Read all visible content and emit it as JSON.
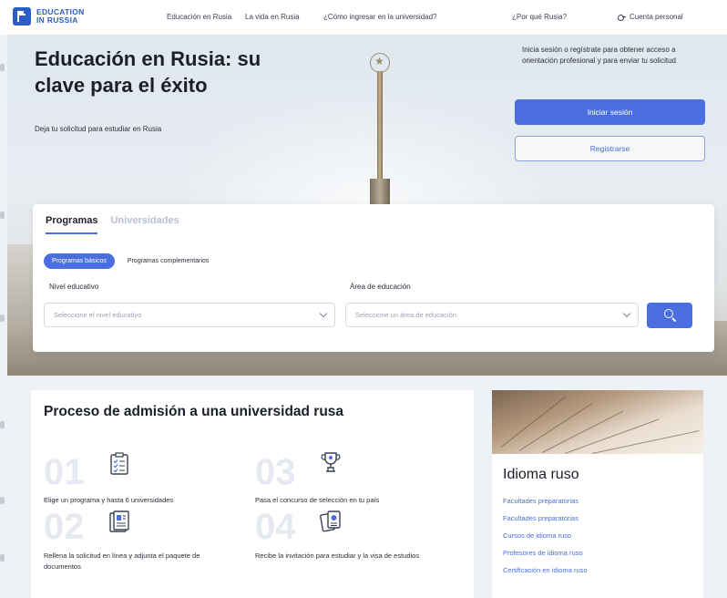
{
  "header": {
    "logo_line1": "EDUCATION",
    "logo_line2": "IN RUSSIA",
    "nav": [
      "Educación en Rusia",
      "La vida en Rusia",
      "¿Cómo ingresar en la universidad?",
      "¿Por qué Rusia?"
    ],
    "account": "Cuenta personal"
  },
  "hero": {
    "title": "Educación en Rusia: su clave para el éxito",
    "subtitle": "Deja tu solicitud para estudiar en Rusia",
    "login_text": "Inicia sesión o regístrate para obtener acceso a orientación profesional y para enviar tu solicitud",
    "login_button": "Iniciar sesión",
    "register_button": "Registrarse"
  },
  "search": {
    "tabs": [
      "Programas",
      "Universidades"
    ],
    "pills": [
      "Programas básicos",
      "Programas complementarios"
    ],
    "level_label": "Nivel educativo",
    "level_placeholder": "Seleccione el nivel educativo",
    "area_label": "Área de educación",
    "area_placeholder": "Seleccione un área de educación"
  },
  "admission": {
    "title": "Proceso de admisión a una universidad rusa",
    "steps": [
      {
        "num": "01",
        "text": "Elige un programa y hasta 6 universidades",
        "icon": "checklist-icon"
      },
      {
        "num": "03",
        "text": "Pasa el concurso de selección en tu país",
        "icon": "trophy-icon"
      },
      {
        "num": "02",
        "text": "Rellena la solicitud en línea y adjunta el paquete de documentos",
        "icon": "document-icon"
      },
      {
        "num": "04",
        "text": "Recibe la invitación para estudiar y la visa de estudios",
        "icon": "passport-icon"
      }
    ]
  },
  "russian": {
    "title": "Idioma ruso",
    "links": [
      "Facultades preparatorias",
      "Facultades preparatorias",
      "Cursos de idioma ruso",
      "Profesores de idioma ruso",
      "Certificación en idioma ruso"
    ]
  },
  "colors": {
    "accent": "#4a6ee0",
    "brand": "#2c5cc5"
  }
}
